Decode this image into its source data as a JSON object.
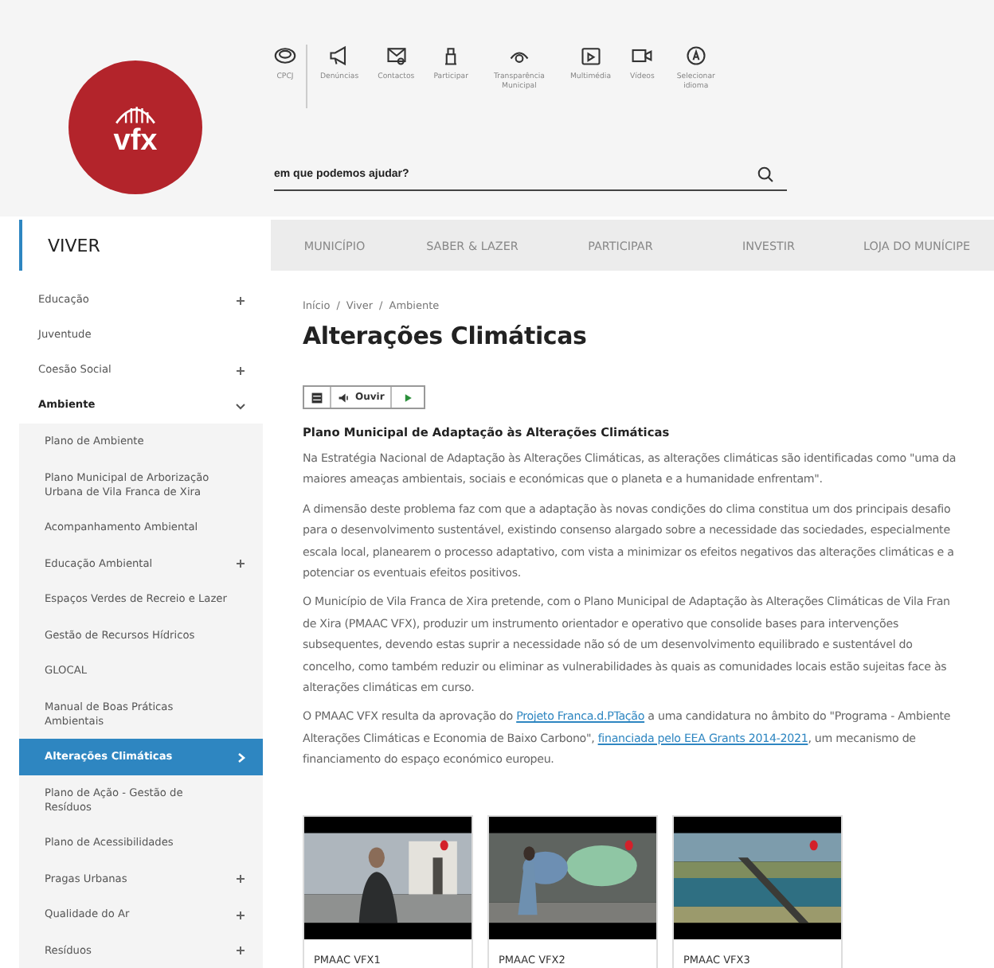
{
  "logo": {
    "text": "vfx"
  },
  "quick_links": [
    {
      "label": "CPCJ"
    },
    {
      "label": "Denúncias"
    },
    {
      "label": "Contactos"
    },
    {
      "label": "Participar"
    },
    {
      "label": "Transparência Municipal"
    },
    {
      "label": "Multimédia"
    },
    {
      "label": "Vídeos"
    },
    {
      "label": "Selecionar idioma"
    }
  ],
  "search": {
    "placeholder": "em que podemos ajudar?"
  },
  "nav": {
    "section": "VIVER",
    "tabs": [
      {
        "label": "MUNICÍPIO",
        "selected": false
      },
      {
        "label": "SABER & LAZER",
        "selected": false
      },
      {
        "label": "PARTICIPAR",
        "selected": false
      },
      {
        "label": "INVESTIR",
        "selected": false
      },
      {
        "label": "LOJA DO MUNÍCIPE",
        "selected": false
      }
    ]
  },
  "sidebar": {
    "items": [
      {
        "label": "Educação",
        "expandable": true,
        "expanded": false,
        "selected": false
      },
      {
        "label": "Juventude",
        "expandable": false,
        "expanded": false,
        "selected": false
      },
      {
        "label": "Coesão Social",
        "expandable": true,
        "expanded": false,
        "selected": false
      },
      {
        "label": "Ambiente",
        "expandable": true,
        "expanded": true,
        "selected": false,
        "children": [
          {
            "label": "Plano de Ambiente",
            "expandable": false,
            "selected": false
          },
          {
            "label": "Plano Municipal de Arborização Urbana de Vila Franca de Xira",
            "expandable": false,
            "selected": false
          },
          {
            "label": "Acompanhamento Ambiental",
            "expandable": false,
            "selected": false
          },
          {
            "label": "Educação Ambiental",
            "expandable": true,
            "selected": false
          },
          {
            "label": "Espaços Verdes de Recreio e Lazer",
            "expandable": false,
            "selected": false
          },
          {
            "label": "Gestão de Recursos Hídricos",
            "expandable": false,
            "selected": false
          },
          {
            "label": "GLOCAL",
            "expandable": false,
            "selected": false
          },
          {
            "label": "Manual de Boas Práticas Ambientais",
            "expandable": false,
            "selected": false
          },
          {
            "label": "Alterações Climáticas",
            "expandable": false,
            "selected": true
          },
          {
            "label": "Plano de Ação - Gestão de Resíduos",
            "expandable": false,
            "selected": false
          },
          {
            "label": "Plano de Acessibilidades",
            "expandable": false,
            "selected": false
          },
          {
            "label": "Pragas Urbanas",
            "expandable": true,
            "selected": false
          },
          {
            "label": "Qualidade do Ar",
            "expandable": true,
            "selected": false
          },
          {
            "label": "Resíduos",
            "expandable": true,
            "selected": false
          }
        ]
      }
    ]
  },
  "breadcrumb": {
    "separator": "/",
    "items": [
      "Início",
      "Viver",
      "Ambiente"
    ]
  },
  "title": "Alterações Climáticas",
  "player": {
    "listen": "Ouvir"
  },
  "heading": "Plano Municipal de Adaptação às Alterações Climáticas",
  "paragraphs": [
    {
      "lines": [
        [
          {
            "text": "Na Estratégia Nacional de Adaptação às Alterações Climáticas, as alterações climáticas são identificadas como \"uma da",
            "kind": "text"
          }
        ],
        [
          {
            "text": "maiores ameaças ambientais, sociais e económicas que o planeta e a humanidade enfrentam\".",
            "kind": "text"
          }
        ]
      ]
    },
    {
      "lines": [
        [
          {
            "text": "A dimensão deste problema faz com que a adaptação às novas condições do clima constitua um dos principais desafio",
            "kind": "text"
          }
        ],
        [
          {
            "text": "para o desenvolvimento sustentável, existindo consenso alargado sobre a necessidade das sociedades, especialmente",
            "kind": "text"
          }
        ],
        [
          {
            "text": "escala local, planearem o processo adaptativo, com vista a minimizar os efeitos negativos das alterações climáticas e a",
            "kind": "text"
          }
        ],
        [
          {
            "text": "potenciar os eventuais efeitos positivos.",
            "kind": "text"
          }
        ]
      ]
    },
    {
      "lines": [
        [
          {
            "text": "O Município de Vila Franca de Xira pretende, com o Plano Municipal de Adaptação às Alterações Climáticas de Vila Fran",
            "kind": "text"
          }
        ],
        [
          {
            "text": "de Xira (PMAAC VFX), produzir um instrumento orientador e operativo que consolide bases para intervenções",
            "kind": "text"
          }
        ],
        [
          {
            "text": "subsequentes, devendo estas suprir a necessidade não só de um desenvolvimento equilibrado e sustentável do",
            "kind": "text"
          }
        ],
        [
          {
            "text": "concelho, como também reduzir ou eliminar as vulnerabilidades às quais as comunidades locais estão sujeitas face às",
            "kind": "text"
          }
        ],
        [
          {
            "text": "alterações climáticas em curso.",
            "kind": "text"
          }
        ]
      ]
    },
    {
      "lines": [
        [
          {
            "text": "O PMAAC VFX resulta da aprovação do ",
            "kind": "text"
          },
          {
            "text": "Projeto Franca.d.PTação",
            "kind": "link"
          },
          {
            "text": " a uma candidatura no âmbito do \"Programa - Ambiente",
            "kind": "text"
          }
        ],
        [
          {
            "text": "Alterações Climáticas e Economia de Baixo Carbono\", ",
            "kind": "text"
          },
          {
            "text": "financiada pelo EEA Grants 2014-2021",
            "kind": "link"
          },
          {
            "text": ", um mecanismo de",
            "kind": "text"
          }
        ],
        [
          {
            "text": "financiamento do espaço económico europeu.",
            "kind": "text"
          }
        ]
      ]
    }
  ],
  "videos": [
    {
      "title": "PMAAC VFX1",
      "kind": "picture"
    },
    {
      "title": "PMAAC VFX2",
      "kind": "picture"
    },
    {
      "title": "PMAAC VFX3",
      "kind": "picture"
    }
  ]
}
